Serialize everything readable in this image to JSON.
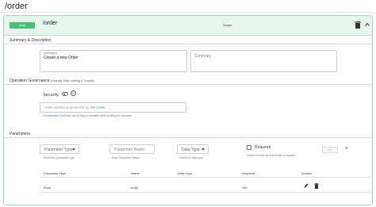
{
  "page": {
    "title": "/order"
  },
  "endpoint": {
    "method": "post",
    "path": "/order",
    "scope_label": "Scope:"
  },
  "summary_section": {
    "title": "Summary & Description",
    "description_caption": "Description",
    "description_value": "Create a new Order",
    "summary_placeholder": "Summary"
  },
  "governance": {
    "title": "Operation Governance",
    "subtitle": "(Security, Rate Limiting & Scopes)",
    "security_label": "Security",
    "help_symbol": "?",
    "rate_text_prefix": "Rate limiting is governed by ",
    "rate_text_link": "API Level",
    "rate_hint_link": "Configuration Level",
    "rate_hint_rest": " are rate limiting is available while limiting per operation"
  },
  "parameters": {
    "title": "Parameters",
    "type_select": "Parameter Type",
    "type_hint": "Select the parameter type",
    "name_placeholder": "Parameter Name",
    "name_hint": "Enter Parameter Name",
    "data_type_select": "Data Type",
    "data_type_hint": "Select the data type",
    "required_label": "Required",
    "required_hint": "Check whether the parameter is required",
    "add_button": "Add",
    "clear_symbol": "×",
    "columns": [
      "Parameter Type",
      "Name",
      "Data Type",
      "Required",
      "Actions"
    ],
    "rows": [
      {
        "type": "Body",
        "name": "body",
        "data_type": "",
        "required": "Yes"
      }
    ]
  },
  "colors": {
    "accent_green": "#49c17a",
    "header_bg": "#e6f6ec",
    "panel_border": "#9fdcb3",
    "link_blue": "#2a88d8"
  },
  "icons": [
    "trash-icon",
    "chevron-up-icon",
    "help-icon",
    "edit-icon",
    "close-icon",
    "dropdown-caret-icon"
  ]
}
